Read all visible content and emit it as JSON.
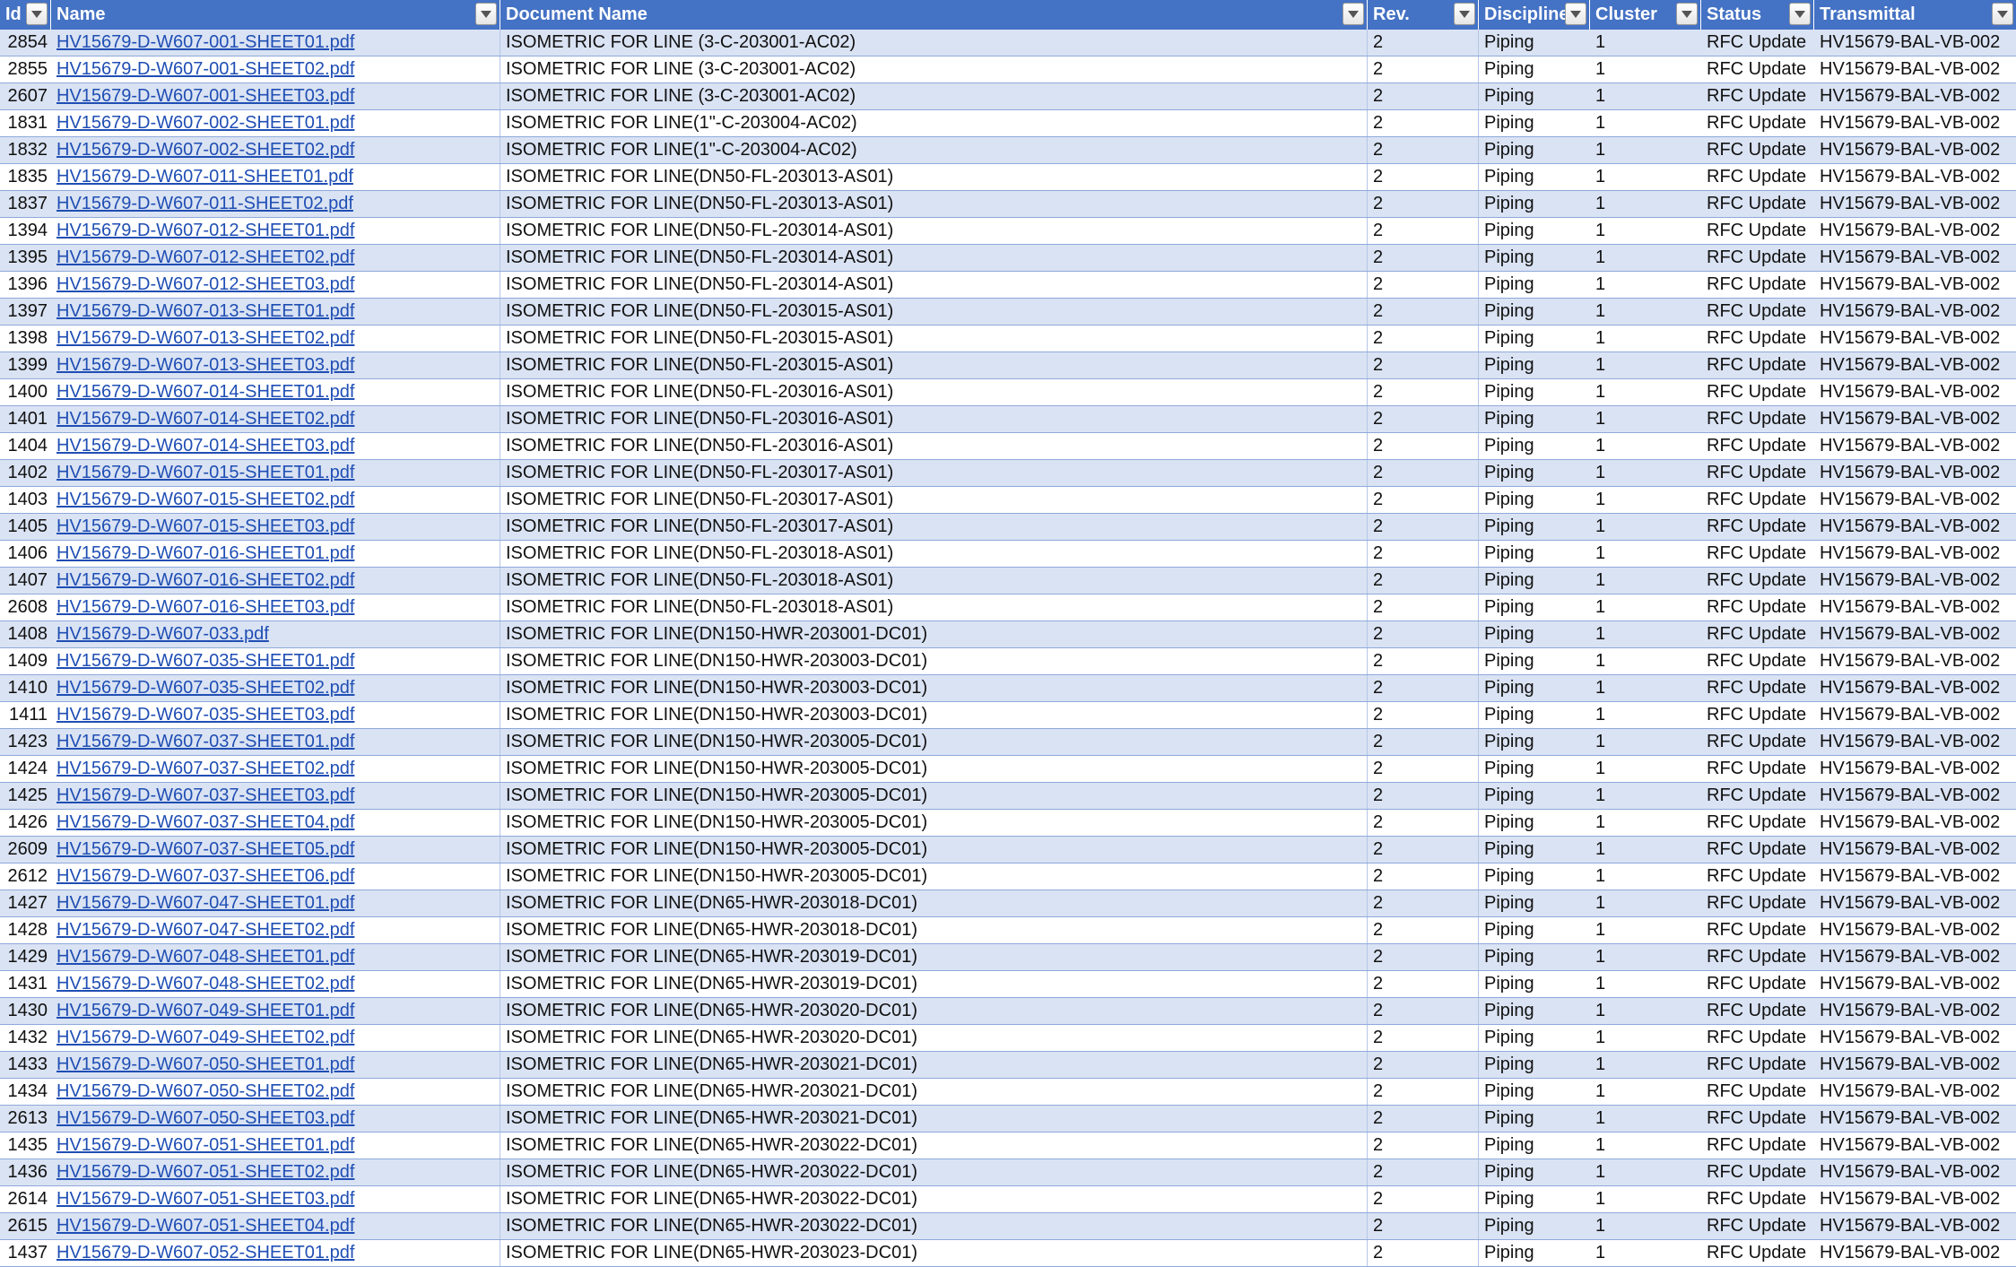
{
  "headers": [
    "Id",
    "Name",
    "Document Name",
    "Rev.",
    "Discipline",
    "Cluster",
    "Status",
    "Transmittal"
  ],
  "rows": [
    [
      "2854",
      "HV15679-D-W607-001-SHEET01.pdf",
      "ISOMETRIC FOR LINE (3-C-203001-AC02)",
      "2",
      "Piping",
      "1",
      "RFC Update",
      "HV15679-BAL-VB-002"
    ],
    [
      "2855",
      "HV15679-D-W607-001-SHEET02.pdf",
      "ISOMETRIC FOR LINE (3-C-203001-AC02)",
      "2",
      "Piping",
      "1",
      "RFC Update",
      "HV15679-BAL-VB-002"
    ],
    [
      "2607",
      "HV15679-D-W607-001-SHEET03.pdf",
      "ISOMETRIC FOR LINE (3-C-203001-AC02)",
      "2",
      "Piping",
      "1",
      "RFC Update",
      "HV15679-BAL-VB-002"
    ],
    [
      "1831",
      "HV15679-D-W607-002-SHEET01.pdf",
      "ISOMETRIC FOR LINE(1\"-C-203004-AC02)",
      "2",
      "Piping",
      "1",
      "RFC Update",
      "HV15679-BAL-VB-002"
    ],
    [
      "1832",
      "HV15679-D-W607-002-SHEET02.pdf",
      "ISOMETRIC FOR LINE(1\"-C-203004-AC02)",
      "2",
      "Piping",
      "1",
      "RFC Update",
      "HV15679-BAL-VB-002"
    ],
    [
      "1835",
      "HV15679-D-W607-011-SHEET01.pdf",
      "ISOMETRIC FOR LINE(DN50-FL-203013-AS01)",
      "2",
      "Piping",
      "1",
      "RFC Update",
      "HV15679-BAL-VB-002"
    ],
    [
      "1837",
      "HV15679-D-W607-011-SHEET02.pdf",
      "ISOMETRIC FOR LINE(DN50-FL-203013-AS01)",
      "2",
      "Piping",
      "1",
      "RFC Update",
      "HV15679-BAL-VB-002"
    ],
    [
      "1394",
      "HV15679-D-W607-012-SHEET01.pdf",
      "ISOMETRIC FOR LINE(DN50-FL-203014-AS01)",
      "2",
      "Piping",
      "1",
      "RFC Update",
      "HV15679-BAL-VB-002"
    ],
    [
      "1395",
      "HV15679-D-W607-012-SHEET02.pdf",
      "ISOMETRIC FOR LINE(DN50-FL-203014-AS01)",
      "2",
      "Piping",
      "1",
      "RFC Update",
      "HV15679-BAL-VB-002"
    ],
    [
      "1396",
      "HV15679-D-W607-012-SHEET03.pdf",
      "ISOMETRIC FOR LINE(DN50-FL-203014-AS01)",
      "2",
      "Piping",
      "1",
      "RFC Update",
      "HV15679-BAL-VB-002"
    ],
    [
      "1397",
      "HV15679-D-W607-013-SHEET01.pdf",
      "ISOMETRIC FOR LINE(DN50-FL-203015-AS01)",
      "2",
      "Piping",
      "1",
      "RFC Update",
      "HV15679-BAL-VB-002"
    ],
    [
      "1398",
      "HV15679-D-W607-013-SHEET02.pdf",
      "ISOMETRIC FOR LINE(DN50-FL-203015-AS01)",
      "2",
      "Piping",
      "1",
      "RFC Update",
      "HV15679-BAL-VB-002"
    ],
    [
      "1399",
      "HV15679-D-W607-013-SHEET03.pdf",
      "ISOMETRIC FOR LINE(DN50-FL-203015-AS01)",
      "2",
      "Piping",
      "1",
      "RFC Update",
      "HV15679-BAL-VB-002"
    ],
    [
      "1400",
      "HV15679-D-W607-014-SHEET01.pdf",
      "ISOMETRIC FOR LINE(DN50-FL-203016-AS01)",
      "2",
      "Piping",
      "1",
      "RFC Update",
      "HV15679-BAL-VB-002"
    ],
    [
      "1401",
      "HV15679-D-W607-014-SHEET02.pdf",
      "ISOMETRIC FOR LINE(DN50-FL-203016-AS01)",
      "2",
      "Piping",
      "1",
      "RFC Update",
      "HV15679-BAL-VB-002"
    ],
    [
      "1404",
      "HV15679-D-W607-014-SHEET03.pdf",
      "ISOMETRIC FOR LINE(DN50-FL-203016-AS01)",
      "2",
      "Piping",
      "1",
      "RFC Update",
      "HV15679-BAL-VB-002"
    ],
    [
      "1402",
      "HV15679-D-W607-015-SHEET01.pdf",
      "ISOMETRIC FOR LINE(DN50-FL-203017-AS01)",
      "2",
      "Piping",
      "1",
      "RFC Update",
      "HV15679-BAL-VB-002"
    ],
    [
      "1403",
      "HV15679-D-W607-015-SHEET02.pdf",
      "ISOMETRIC FOR LINE(DN50-FL-203017-AS01)",
      "2",
      "Piping",
      "1",
      "RFC Update",
      "HV15679-BAL-VB-002"
    ],
    [
      "1405",
      "HV15679-D-W607-015-SHEET03.pdf",
      "ISOMETRIC FOR LINE(DN50-FL-203017-AS01)",
      "2",
      "Piping",
      "1",
      "RFC Update",
      "HV15679-BAL-VB-002"
    ],
    [
      "1406",
      "HV15679-D-W607-016-SHEET01.pdf",
      "ISOMETRIC FOR LINE(DN50-FL-203018-AS01)",
      "2",
      "Piping",
      "1",
      "RFC Update",
      "HV15679-BAL-VB-002"
    ],
    [
      "1407",
      "HV15679-D-W607-016-SHEET02.pdf",
      "ISOMETRIC FOR LINE(DN50-FL-203018-AS01)",
      "2",
      "Piping",
      "1",
      "RFC Update",
      "HV15679-BAL-VB-002"
    ],
    [
      "2608",
      "HV15679-D-W607-016-SHEET03.pdf",
      "ISOMETRIC FOR LINE(DN50-FL-203018-AS01)",
      "2",
      "Piping",
      "1",
      "RFC Update",
      "HV15679-BAL-VB-002"
    ],
    [
      "1408",
      "HV15679-D-W607-033.pdf",
      "ISOMETRIC FOR LINE(DN150-HWR-203001-DC01)",
      "2",
      "Piping",
      "1",
      "RFC Update",
      "HV15679-BAL-VB-002"
    ],
    [
      "1409",
      "HV15679-D-W607-035-SHEET01.pdf",
      "ISOMETRIC FOR LINE(DN150-HWR-203003-DC01)",
      "2",
      "Piping",
      "1",
      "RFC Update",
      "HV15679-BAL-VB-002"
    ],
    [
      "1410",
      "HV15679-D-W607-035-SHEET02.pdf",
      "ISOMETRIC FOR LINE(DN150-HWR-203003-DC01)",
      "2",
      "Piping",
      "1",
      "RFC Update",
      "HV15679-BAL-VB-002"
    ],
    [
      "1411",
      "HV15679-D-W607-035-SHEET03.pdf",
      "ISOMETRIC FOR LINE(DN150-HWR-203003-DC01)",
      "2",
      "Piping",
      "1",
      "RFC Update",
      "HV15679-BAL-VB-002"
    ],
    [
      "1423",
      "HV15679-D-W607-037-SHEET01.pdf",
      "ISOMETRIC FOR LINE(DN150-HWR-203005-DC01)",
      "2",
      "Piping",
      "1",
      "RFC Update",
      "HV15679-BAL-VB-002"
    ],
    [
      "1424",
      "HV15679-D-W607-037-SHEET02.pdf",
      "ISOMETRIC FOR LINE(DN150-HWR-203005-DC01)",
      "2",
      "Piping",
      "1",
      "RFC Update",
      "HV15679-BAL-VB-002"
    ],
    [
      "1425",
      "HV15679-D-W607-037-SHEET03.pdf",
      "ISOMETRIC FOR LINE(DN150-HWR-203005-DC01)",
      "2",
      "Piping",
      "1",
      "RFC Update",
      "HV15679-BAL-VB-002"
    ],
    [
      "1426",
      "HV15679-D-W607-037-SHEET04.pdf",
      "ISOMETRIC FOR LINE(DN150-HWR-203005-DC01)",
      "2",
      "Piping",
      "1",
      "RFC Update",
      "HV15679-BAL-VB-002"
    ],
    [
      "2609",
      "HV15679-D-W607-037-SHEET05.pdf",
      "ISOMETRIC FOR LINE(DN150-HWR-203005-DC01)",
      "2",
      "Piping",
      "1",
      "RFC Update",
      "HV15679-BAL-VB-002"
    ],
    [
      "2612",
      "HV15679-D-W607-037-SHEET06.pdf",
      "ISOMETRIC FOR LINE(DN150-HWR-203005-DC01)",
      "2",
      "Piping",
      "1",
      "RFC Update",
      "HV15679-BAL-VB-002"
    ],
    [
      "1427",
      "HV15679-D-W607-047-SHEET01.pdf",
      "ISOMETRIC FOR LINE(DN65-HWR-203018-DC01)",
      "2",
      "Piping",
      "1",
      "RFC Update",
      "HV15679-BAL-VB-002"
    ],
    [
      "1428",
      "HV15679-D-W607-047-SHEET02.pdf",
      "ISOMETRIC FOR LINE(DN65-HWR-203018-DC01)",
      "2",
      "Piping",
      "1",
      "RFC Update",
      "HV15679-BAL-VB-002"
    ],
    [
      "1429",
      "HV15679-D-W607-048-SHEET01.pdf",
      "ISOMETRIC FOR LINE(DN65-HWR-203019-DC01)",
      "2",
      "Piping",
      "1",
      "RFC Update",
      "HV15679-BAL-VB-002"
    ],
    [
      "1431",
      "HV15679-D-W607-048-SHEET02.pdf",
      "ISOMETRIC FOR LINE(DN65-HWR-203019-DC01)",
      "2",
      "Piping",
      "1",
      "RFC Update",
      "HV15679-BAL-VB-002"
    ],
    [
      "1430",
      "HV15679-D-W607-049-SHEET01.pdf",
      "ISOMETRIC FOR LINE(DN65-HWR-203020-DC01)",
      "2",
      "Piping",
      "1",
      "RFC Update",
      "HV15679-BAL-VB-002"
    ],
    [
      "1432",
      "HV15679-D-W607-049-SHEET02.pdf",
      "ISOMETRIC FOR LINE(DN65-HWR-203020-DC01)",
      "2",
      "Piping",
      "1",
      "RFC Update",
      "HV15679-BAL-VB-002"
    ],
    [
      "1433",
      "HV15679-D-W607-050-SHEET01.pdf",
      "ISOMETRIC FOR LINE(DN65-HWR-203021-DC01)",
      "2",
      "Piping",
      "1",
      "RFC Update",
      "HV15679-BAL-VB-002"
    ],
    [
      "1434",
      "HV15679-D-W607-050-SHEET02.pdf",
      "ISOMETRIC FOR LINE(DN65-HWR-203021-DC01)",
      "2",
      "Piping",
      "1",
      "RFC Update",
      "HV15679-BAL-VB-002"
    ],
    [
      "2613",
      "HV15679-D-W607-050-SHEET03.pdf",
      "ISOMETRIC FOR LINE(DN65-HWR-203021-DC01)",
      "2",
      "Piping",
      "1",
      "RFC Update",
      "HV15679-BAL-VB-002"
    ],
    [
      "1435",
      "HV15679-D-W607-051-SHEET01.pdf",
      "ISOMETRIC FOR LINE(DN65-HWR-203022-DC01)",
      "2",
      "Piping",
      "1",
      "RFC Update",
      "HV15679-BAL-VB-002"
    ],
    [
      "1436",
      "HV15679-D-W607-051-SHEET02.pdf",
      "ISOMETRIC FOR LINE(DN65-HWR-203022-DC01)",
      "2",
      "Piping",
      "1",
      "RFC Update",
      "HV15679-BAL-VB-002"
    ],
    [
      "2614",
      "HV15679-D-W607-051-SHEET03.pdf",
      "ISOMETRIC FOR LINE(DN65-HWR-203022-DC01)",
      "2",
      "Piping",
      "1",
      "RFC Update",
      "HV15679-BAL-VB-002"
    ],
    [
      "2615",
      "HV15679-D-W607-051-SHEET04.pdf",
      "ISOMETRIC FOR LINE(DN65-HWR-203022-DC01)",
      "2",
      "Piping",
      "1",
      "RFC Update",
      "HV15679-BAL-VB-002"
    ],
    [
      "1437",
      "HV15679-D-W607-052-SHEET01.pdf",
      "ISOMETRIC FOR LINE(DN65-HWR-203023-DC01)",
      "2",
      "Piping",
      "1",
      "RFC Update",
      "HV15679-BAL-VB-002"
    ]
  ],
  "colors": {
    "header_bg": "#4472c4",
    "band_row": "#dae3f3",
    "link": "#1f4eb4"
  }
}
